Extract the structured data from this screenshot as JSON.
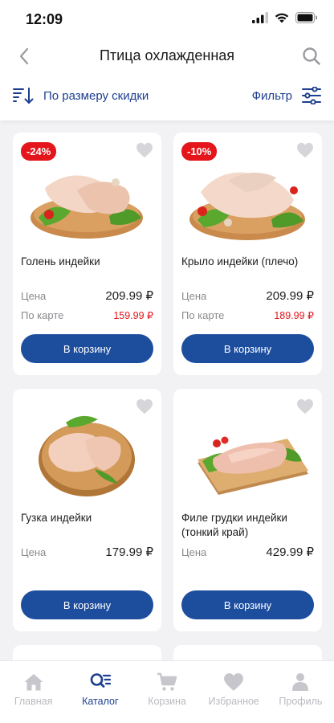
{
  "status": {
    "time": "12:09"
  },
  "header": {
    "title": "Птица охлажденная"
  },
  "toolbar": {
    "sort_label": "По размеру скидки",
    "filter_label": "Фильтр"
  },
  "products": [
    {
      "name": "Голень индейки",
      "badge": "-24%",
      "price_label": "Цена",
      "price": "209.99 ₽",
      "card_label": "По карте",
      "card_price": "159.99 ₽",
      "button": "В корзину"
    },
    {
      "name": "Крыло индейки (плечо)",
      "badge": "-10%",
      "price_label": "Цена",
      "price": "209.99 ₽",
      "card_label": "По карте",
      "card_price": "189.99 ₽",
      "button": "В корзину"
    },
    {
      "name": "Гузка индейки",
      "price_label": "Цена",
      "price": "179.99 ₽",
      "button": "В корзину"
    },
    {
      "name": "Филе грудки индейки (тонкий край)",
      "price_label": "Цена",
      "price": "429.99 ₽",
      "button": "В корзину"
    }
  ],
  "tabs": [
    {
      "label": "Главная",
      "icon": "home-icon"
    },
    {
      "label": "Каталог",
      "icon": "catalog-search-icon",
      "active": true
    },
    {
      "label": "Корзина",
      "icon": "cart-icon"
    },
    {
      "label": "Избранное",
      "icon": "heart-icon"
    },
    {
      "label": "Профиль",
      "icon": "profile-icon"
    }
  ],
  "colors": {
    "accent": "#1d4e9e",
    "badge": "#e4161b",
    "tab_active": "#1d3f8f",
    "tab_inactive": "#b9b9bf"
  }
}
